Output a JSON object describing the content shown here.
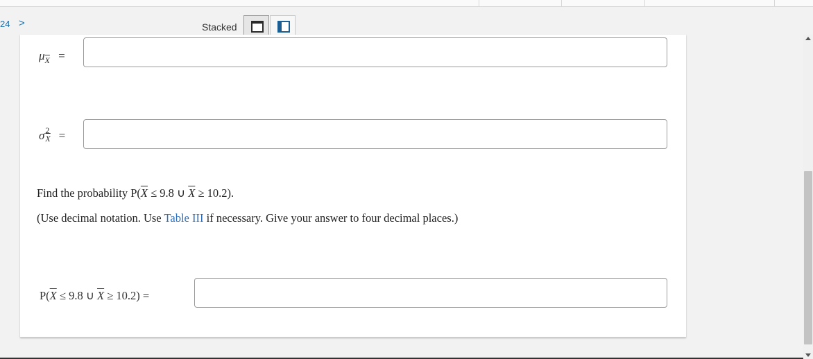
{
  "nav": {
    "question_number": "24",
    "next_chevron": ">"
  },
  "view": {
    "label": "Stacked",
    "stacked_icon": "stacked-layout-icon",
    "side_icon": "side-by-side-layout-icon"
  },
  "fields": {
    "mu": {
      "symbol": "μ",
      "sub": "X",
      "eq": "=",
      "value": ""
    },
    "sigma": {
      "symbol": "σ",
      "sup": "2",
      "sub": "X",
      "eq": "=",
      "value": ""
    }
  },
  "question": {
    "prefix": "Find the probability P(",
    "x1": "X",
    "mid1": " ≤ 9.8 ∪ ",
    "x2": "X",
    "suffix": " ≥ 10.2)."
  },
  "instructions": {
    "before": "(Use decimal notation. Use ",
    "link": "Table III",
    "after": " if necessary. Give your answer to four decimal places.)"
  },
  "answer": {
    "prefix": "P(",
    "x1": "X",
    "mid1": " ≤ 9.8 ∪ ",
    "x2": "X",
    "suffix": " ≥ 10.2) =",
    "value": ""
  }
}
